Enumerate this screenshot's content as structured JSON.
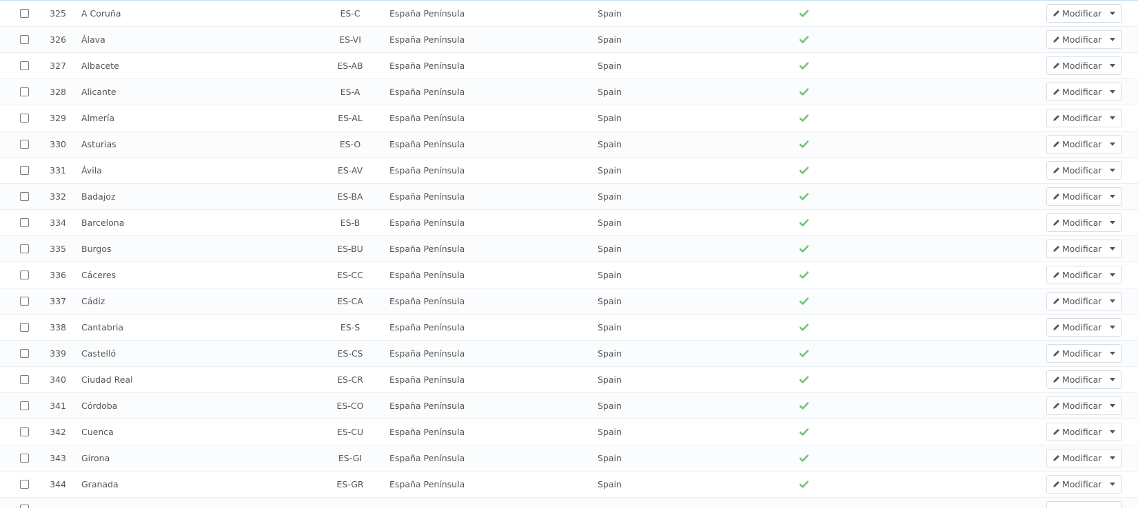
{
  "table": {
    "action_label": "Modificar",
    "status_icon": "check-icon",
    "colors": {
      "check": "#72c279",
      "border": "#d8dde2",
      "text": "#555555"
    },
    "rows": [
      {
        "id": "325",
        "name": "A Coruña",
        "iso": "ES-C",
        "zone": "España Península",
        "country": "Spain"
      },
      {
        "id": "326",
        "name": "Álava",
        "iso": "ES-VI",
        "zone": "España Península",
        "country": "Spain"
      },
      {
        "id": "327",
        "name": "Albacete",
        "iso": "ES-AB",
        "zone": "España Península",
        "country": "Spain"
      },
      {
        "id": "328",
        "name": "Alicante",
        "iso": "ES-A",
        "zone": "España Península",
        "country": "Spain"
      },
      {
        "id": "329",
        "name": "Almería",
        "iso": "ES-AL",
        "zone": "España Península",
        "country": "Spain"
      },
      {
        "id": "330",
        "name": "Asturias",
        "iso": "ES-O",
        "zone": "España Península",
        "country": "Spain"
      },
      {
        "id": "331",
        "name": "Ávila",
        "iso": "ES-AV",
        "zone": "España Península",
        "country": "Spain"
      },
      {
        "id": "332",
        "name": "Badajoz",
        "iso": "ES-BA",
        "zone": "España Península",
        "country": "Spain"
      },
      {
        "id": "334",
        "name": "Barcelona",
        "iso": "ES-B",
        "zone": "España Península",
        "country": "Spain"
      },
      {
        "id": "335",
        "name": "Burgos",
        "iso": "ES-BU",
        "zone": "España Península",
        "country": "Spain"
      },
      {
        "id": "336",
        "name": "Cáceres",
        "iso": "ES-CC",
        "zone": "España Península",
        "country": "Spain"
      },
      {
        "id": "337",
        "name": "Cádiz",
        "iso": "ES-CA",
        "zone": "España Península",
        "country": "Spain"
      },
      {
        "id": "338",
        "name": "Cantabria",
        "iso": "ES-S",
        "zone": "España Península",
        "country": "Spain"
      },
      {
        "id": "339",
        "name": "Castelló",
        "iso": "ES-CS",
        "zone": "España Península",
        "country": "Spain"
      },
      {
        "id": "340",
        "name": "Ciudad Real",
        "iso": "ES-CR",
        "zone": "España Península",
        "country": "Spain"
      },
      {
        "id": "341",
        "name": "Córdoba",
        "iso": "ES-CO",
        "zone": "España Península",
        "country": "Spain"
      },
      {
        "id": "342",
        "name": "Cuenca",
        "iso": "ES-CU",
        "zone": "España Península",
        "country": "Spain"
      },
      {
        "id": "343",
        "name": "Girona",
        "iso": "ES-GI",
        "zone": "España Península",
        "country": "Spain"
      },
      {
        "id": "344",
        "name": "Granada",
        "iso": "ES-GR",
        "zone": "España Península",
        "country": "Spain"
      }
    ]
  }
}
